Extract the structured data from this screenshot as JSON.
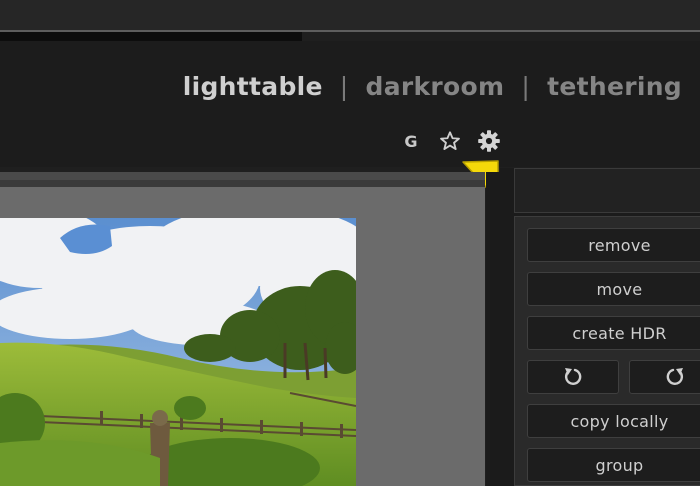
{
  "views": {
    "lighttable": "lighttable",
    "separator": "|",
    "darkroom": "darkroom",
    "tethering": "tethering",
    "active": "lighttable"
  },
  "toolbar": {
    "grouping_label": "G",
    "icons": [
      "grouping-icon",
      "star-icon",
      "gear-icon"
    ]
  },
  "highlight_arrow_color": "#f5d90a",
  "selected_images": {
    "buttons": {
      "remove": "remove",
      "move": "move",
      "create_hdr": "create HDR",
      "copy_locally": "copy locally",
      "group": "group"
    },
    "rotate_icons": [
      "rotate-ccw-icon",
      "rotate-cw-icon"
    ]
  },
  "colors": {
    "active_view": "#cfcfcf",
    "inactive_view": "#858585",
    "accent_arrow": "#f5d90a"
  }
}
